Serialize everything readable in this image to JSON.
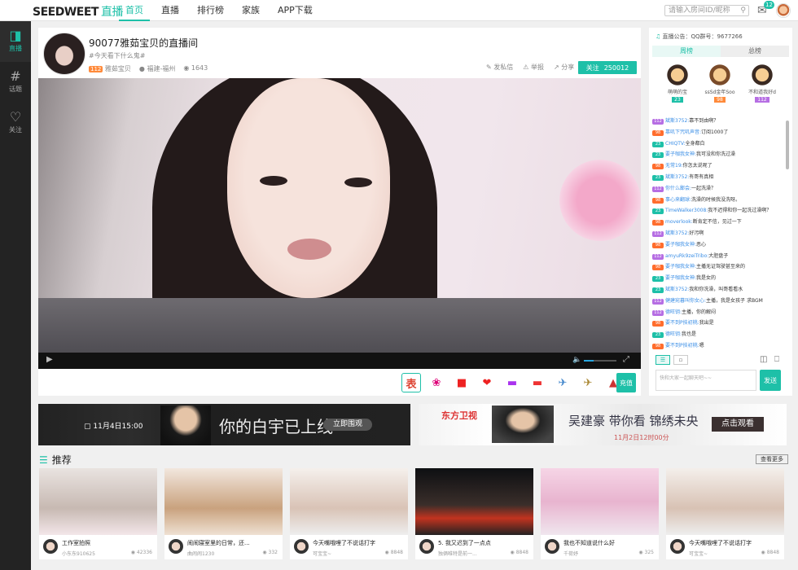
{
  "topbar": {
    "logo": "SEEDWEET",
    "logo_zh": "直播",
    "nav": [
      "首页",
      "直播",
      "排行榜",
      "家族",
      "APP下载"
    ],
    "search_placeholder": "请输入房间ID/昵称",
    "mail_badge": "12"
  },
  "sidebar": {
    "items": [
      {
        "label": "直播",
        "icon": "tv-icon"
      },
      {
        "label": "话题",
        "icon": "hash-icon"
      },
      {
        "label": "关注",
        "icon": "heart-icon"
      }
    ]
  },
  "room": {
    "title": "90077雅茹宝贝的直播间",
    "subtitle": "#今天看下什么鬼#",
    "level": "112",
    "host_name": "雅茹宝贝",
    "location": "福建-福州",
    "viewers": "1643",
    "actions": [
      "发私信",
      "举报",
      "分享"
    ],
    "follow_label": "关注",
    "follow_count": "250012",
    "recharge": "充值",
    "gifts": [
      "gift-text-icon",
      "gift-lollipop-icon",
      "gift-redbox-icon",
      "gift-lips-icon",
      "gift-car-icon",
      "gift-sportscar-icon",
      "gift-plane-icon",
      "gift-jet-icon",
      "gift-rocket-icon"
    ],
    "gift_first_label": "表"
  },
  "right": {
    "notice": "直播公告：QQ群号：9677266",
    "tabs": [
      "周榜",
      "总榜"
    ],
    "ranks": [
      {
        "name": "萌萌的宝",
        "badge": "23",
        "no": "No.1"
      },
      {
        "name": "ssSd金年Soo",
        "badge": "98",
        "no": "No.2"
      },
      {
        "name": "不和道我好d",
        "badge": "112",
        "no": "No.3"
      }
    ],
    "chat": [
      {
        "lvl": "112",
        "user": "斌斯3752:",
        "text": "靠不到由啊？"
      },
      {
        "lvl": "98",
        "user": "靠叽下咒叽声音:",
        "text": "订阅1000了"
      },
      {
        "lvl": "23",
        "user": "CHIQTV:",
        "text": "全身都白"
      },
      {
        "lvl": "23",
        "user": "要子咖我女神:",
        "text": "我可没和你洗过澡"
      },
      {
        "lvl": "98",
        "user": "无常19:",
        "text": "你怎太说呢了"
      },
      {
        "lvl": "23",
        "user": "斌斯3752:",
        "text": "有哥有真相"
      },
      {
        "lvl": "112",
        "user": "你什么鄙会:",
        "text": "一起洗澡？"
      },
      {
        "lvl": "98",
        "user": "事心来翻球:",
        "text": "洗澡的时候我没洗呀。"
      },
      {
        "lvl": "23",
        "user": "TimeWalker3008:",
        "text": "我不迟得和你一起洗过澡啊？"
      },
      {
        "lvl": "98",
        "user": "moverlook:",
        "text": "断肯定不信，见过一下"
      },
      {
        "lvl": "112",
        "user": "斌斯3752:",
        "text": "好污啊"
      },
      {
        "lvl": "98",
        "user": "要子咖我女神:",
        "text": "恶心"
      },
      {
        "lvl": "112",
        "user": "amyuRk9zeiTribo:",
        "text": "大胆盘子"
      },
      {
        "lvl": "98",
        "user": "要子咖我女神:",
        "text": "主播无证驾驶甚至来的"
      },
      {
        "lvl": "23",
        "user": "要子咖我女神:",
        "text": "我是女的"
      },
      {
        "lvl": "23",
        "user": "斌斯3752:",
        "text": "我和你洗澡，叫哥看看水"
      },
      {
        "lvl": "112",
        "user": "健建宛暮叫你女心:",
        "text": "主播，我是女孩子 求BGM"
      },
      {
        "lvl": "112",
        "user": "德旺钥:",
        "text": "主播，你的解闷"
      },
      {
        "lvl": "98",
        "user": "要不到P技初桃:",
        "text": "我出是"
      },
      {
        "lvl": "23",
        "user": "德旺钥:",
        "text": "我也是"
      },
      {
        "lvl": "98",
        "user": "要不到P技初桃:",
        "text": "嗯"
      }
    ],
    "input_placeholder": "快和大家一起聊天吧~~",
    "send": "发送"
  },
  "banners": {
    "b1_date": "11月4日15:00",
    "b1_text": "你的白宇已上线",
    "b1_btn": "立即围观",
    "b2_channel": "东方卫视",
    "b2_text": "吴建豪 带你看 锦绣未央",
    "b2_sub": "11月2日12时00分",
    "b2_btn": "点击观看"
  },
  "recommend": {
    "title": "推荐",
    "more": "查看更多",
    "cards": [
      {
        "title": "工作室拍照",
        "name": "小东东910625",
        "viewers": "42336"
      },
      {
        "title": "闹闹寝室里的日常，还...",
        "name": "曲闹闹1230",
        "viewers": "332"
      },
      {
        "title": "今天嘴哦哩了不说话打字",
        "name": "可宝宝~",
        "viewers": "8848"
      },
      {
        "title": "5. 我又迟到了一点点",
        "name": "独俩唯特是前一...",
        "viewers": "8848"
      },
      {
        "title": "我也不知道说什么好",
        "name": "千荷妤",
        "viewers": "325"
      },
      {
        "title": "今天嘴哦哩了不说话打字",
        "name": "可宝宝~",
        "viewers": "8848"
      }
    ]
  }
}
